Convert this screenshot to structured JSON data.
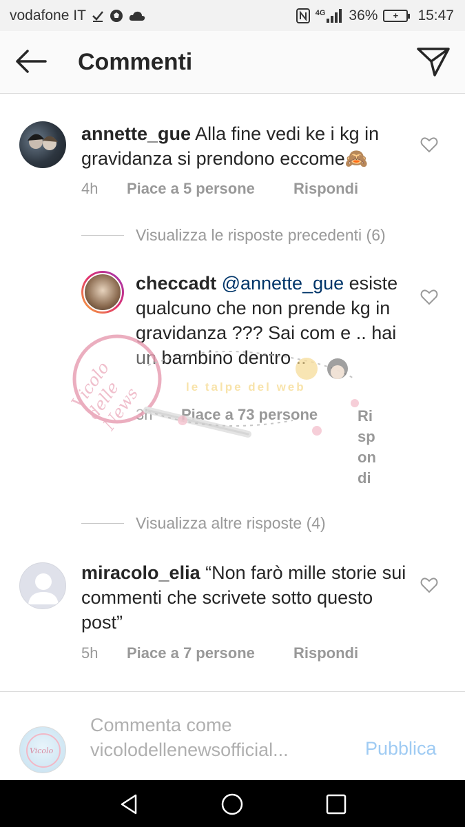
{
  "status_bar": {
    "carrier": "vodafone IT",
    "network": "4G",
    "battery": "36%",
    "time": "15:47"
  },
  "header": {
    "title": "Commenti"
  },
  "comments": [
    {
      "username": "annette_gue",
      "text": "Alla fine vedi ke i kg in gravidanza si prendono eccome🙈",
      "time": "4h",
      "likes": "Piace a 5 persone",
      "reply": "Rispondi"
    },
    {
      "username": "miracolo_elia",
      "text": "“Non farò mille storie sui commenti che scrivete sotto questo post”",
      "time": "5h",
      "likes": "Piace a 7 persone",
      "reply": "Rispondi"
    }
  ],
  "previous_replies": "Visualizza le risposte precedenti (6)",
  "reply": {
    "username": "checcadt",
    "mention": "@annette_gue",
    "text": "esiste qualcuno che non prende kg in gravidanza ??? Sai com e .. hai un bambino dentro ..",
    "time": "3h",
    "likes": "Piace a 73 persone",
    "reply_lines": [
      "Ri",
      "sp",
      "on",
      "di"
    ]
  },
  "more_replies": "Visualizza altre risposte (4)",
  "watermark": {
    "brand": "Vicolo delle News",
    "tagline": "le talpe del web"
  },
  "compose": {
    "placeholder": "Commenta come vicolodellenewsofficial...",
    "publish": "Pubblica"
  },
  "colors": {
    "link": "#003569",
    "meta": "#999999",
    "publish": "#9fcbf3",
    "watermark_pink": "#e8a0b4"
  }
}
